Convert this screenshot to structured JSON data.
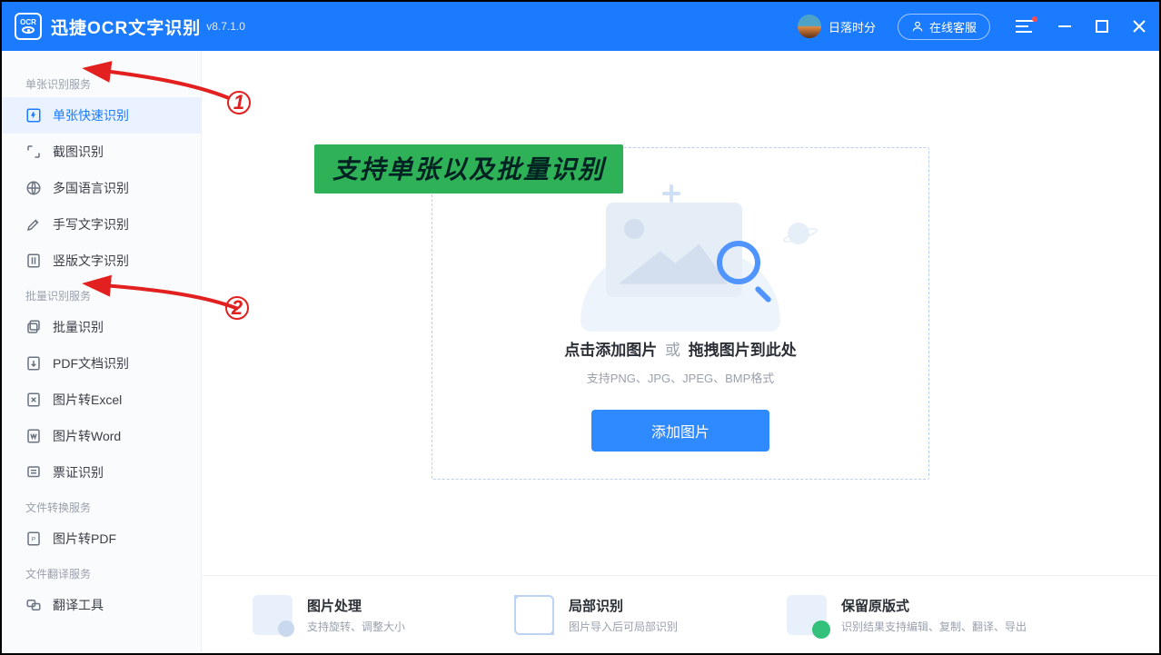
{
  "header": {
    "app_name": "迅捷OCR文字识别",
    "version": "v8.7.1.0",
    "user_name": "日落时分",
    "customer_service": "在线客服"
  },
  "sidebar": {
    "section1": "单张识别服务",
    "items1": [
      {
        "label": "单张快速识别",
        "icon": "single-fast-icon"
      },
      {
        "label": "截图识别",
        "icon": "screenshot-icon"
      },
      {
        "label": "多国语言识别",
        "icon": "globe-icon"
      },
      {
        "label": "手写文字识别",
        "icon": "handwriting-icon"
      },
      {
        "label": "竖版文字识别",
        "icon": "vertical-text-icon"
      }
    ],
    "section2": "批量识别服务",
    "items2": [
      {
        "label": "批量识别",
        "icon": "batch-icon"
      },
      {
        "label": "PDF文档识别",
        "icon": "pdf-icon"
      },
      {
        "label": "图片转Excel",
        "icon": "excel-icon"
      },
      {
        "label": "图片转Word",
        "icon": "word-icon"
      },
      {
        "label": "票证识别",
        "icon": "receipt-icon"
      }
    ],
    "section3": "文件转换服务",
    "items3": [
      {
        "label": "图片转PDF",
        "icon": "image-pdf-icon"
      }
    ],
    "section4": "文件翻译服务",
    "items4": [
      {
        "label": "翻译工具",
        "icon": "translate-icon"
      }
    ]
  },
  "banner": "支持单张以及批量识别",
  "dropzone": {
    "click_text": "点击添加图片",
    "or": "或",
    "drag_text": "拖拽图片到此处",
    "subtext": "支持PNG、JPG、JPEG、BMP格式",
    "button": "添加图片"
  },
  "features": [
    {
      "title": "图片处理",
      "desc": "支持旋转、调整大小"
    },
    {
      "title": "局部识别",
      "desc": "图片导入后可局部识别"
    },
    {
      "title": "保留原版式",
      "desc": "识别结果支持编辑、复制、翻译、导出"
    }
  ],
  "annotations": {
    "num1": "1",
    "num2": "2"
  }
}
